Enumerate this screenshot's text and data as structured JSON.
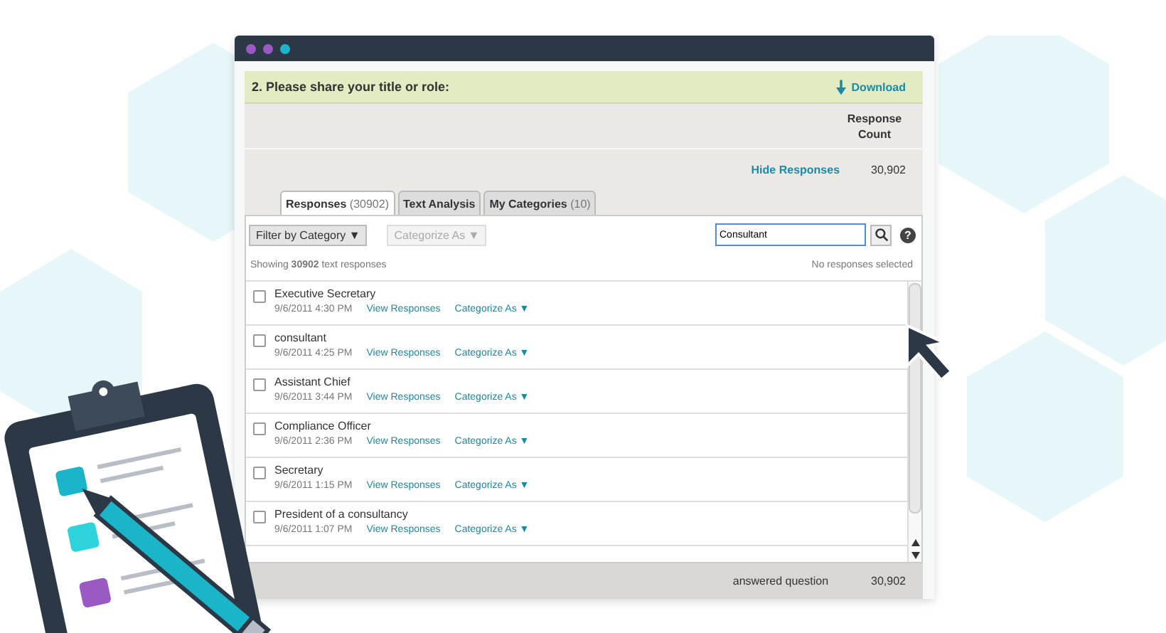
{
  "question": {
    "title": "2. Please share your title or role:",
    "download": "Download"
  },
  "summary": {
    "column_header": "Response Count",
    "toggle_link": "Hide Responses",
    "count": "30,902"
  },
  "tabs": [
    {
      "label": "Responses",
      "count": "(30902)",
      "selected": true
    },
    {
      "label": "Text Analysis",
      "selected": false
    },
    {
      "label": "My Categories",
      "count": "(10)",
      "selected": false
    }
  ],
  "toolbar": {
    "filter": "Filter by Category ▼",
    "categorize": "Categorize As ▼",
    "categorize_disabled": true,
    "search_value": "Consultant",
    "help": "?"
  },
  "status": {
    "showing": "Showing **30902** text responses",
    "selection": "No responses selected"
  },
  "responses": [
    {
      "text": "Executive Secretary",
      "time": "9/6/2011 4:30 PM",
      "view_link": "View Responses",
      "categorize": "Categorize As ▼",
      "checked": false
    },
    {
      "text": "consultant",
      "time": "9/6/2011 4:25 PM",
      "view_link": "View Responses",
      "categorize": "Categorize As ▼",
      "checked": false
    },
    {
      "text": "Assistant Chief",
      "time": "9/6/2011 3:44 PM",
      "view_link": "View Responses",
      "categorize": "Categorize As ▼",
      "checked": false
    },
    {
      "text": "Compliance Officer",
      "time": "9/6/2011 2:36 PM",
      "view_link": "View Responses",
      "categorize": "Categorize As ▼",
      "checked": false
    },
    {
      "text": "Secretary",
      "time": "9/6/2011 1:15 PM",
      "view_link": "View Responses",
      "categorize": "Categorize As ▼",
      "checked": false
    },
    {
      "text": "President of a consultancy",
      "time": "9/6/2011 1:07 PM",
      "view_link": "View Responses",
      "categorize": "Categorize As ▼",
      "checked": false
    }
  ],
  "footer": {
    "label": "answered question",
    "count": "30,902"
  }
}
